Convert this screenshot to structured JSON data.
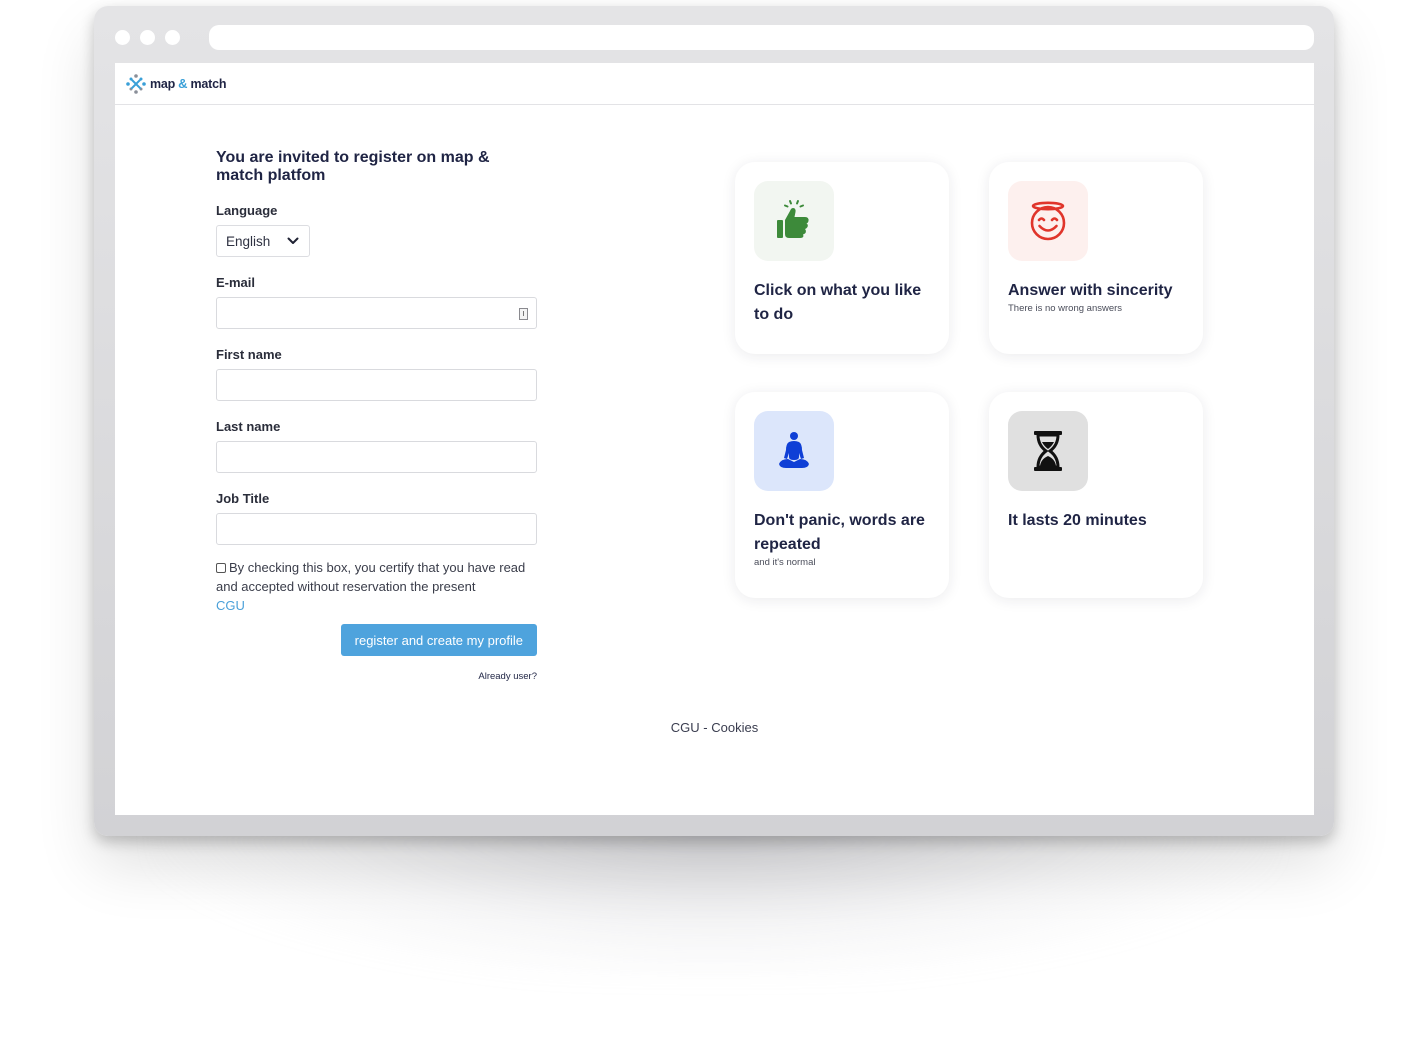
{
  "browser": {
    "window_buttons": [
      "close",
      "minimize",
      "maximize"
    ],
    "url": ""
  },
  "header": {
    "logo_icon": "map-match-logo-icon",
    "logo_text_left": "map",
    "logo_amp": "&",
    "logo_text_right": "match"
  },
  "form": {
    "title": "You are invited to register on map & match platfom",
    "language_label": "Language",
    "language_value": "English",
    "email_label": "E-mail",
    "email_value": "",
    "first_name_label": "First name",
    "first_name_value": "",
    "last_name_label": "Last name",
    "last_name_value": "",
    "job_title_label": "Job Title",
    "job_title_value": "",
    "consent_text": "By checking this box, you certify that you have read and accepted without reservation the present",
    "consent_link": "CGU",
    "consent_checked": false,
    "submit_label": "register and create my profile",
    "already_user": "Already user?"
  },
  "cards": [
    {
      "icon": "thumbs-up-icon",
      "icon_bg": "#f2f6f1",
      "icon_color": "#3d8a3a",
      "title": "Click on what you like to do",
      "subtitle": ""
    },
    {
      "icon": "smiling-halo-icon",
      "icon_bg": "#fdf0ee",
      "icon_color": "#e0352b",
      "title": "Answer with sincerity",
      "subtitle": "There is no wrong answers"
    },
    {
      "icon": "meditation-icon",
      "icon_bg": "#dce6fb",
      "icon_color": "#0f3fd6",
      "title": "Don't panic, words are repeated",
      "subtitle": "and it's normal"
    },
    {
      "icon": "hourglass-icon",
      "icon_bg": "#e0e0e0",
      "icon_color": "#111111",
      "title": "It lasts 20 minutes",
      "subtitle": ""
    }
  ],
  "footer": {
    "text": "CGU - Cookies"
  },
  "colors": {
    "accent": "#4ea3dd",
    "text_dark": "#1f2444"
  }
}
